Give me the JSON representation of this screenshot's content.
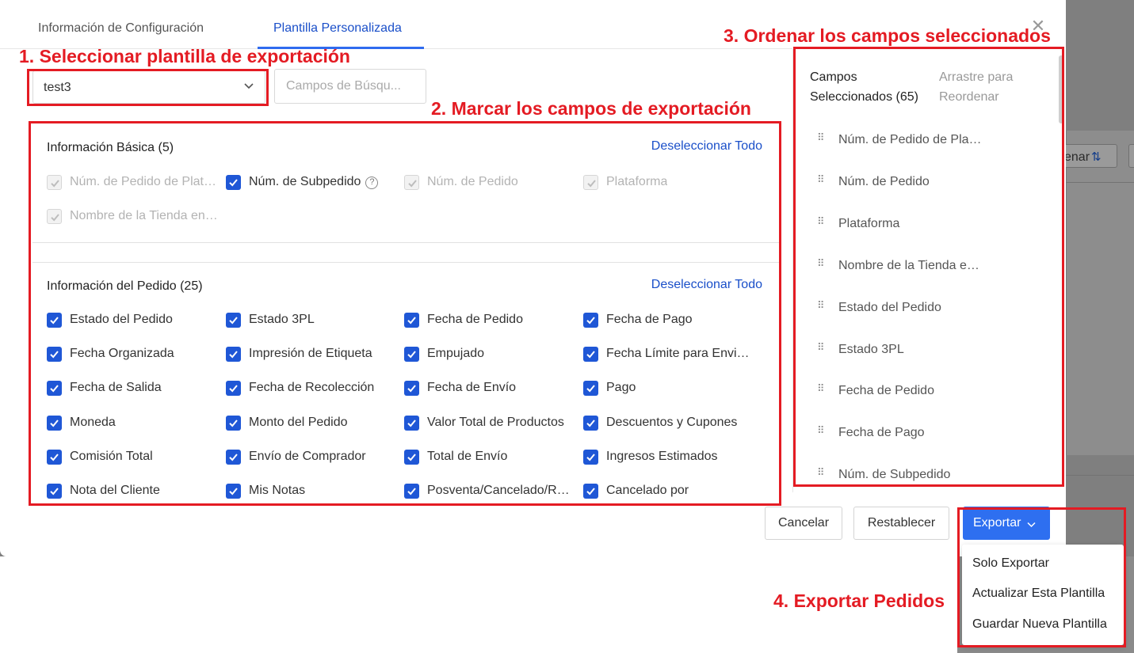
{
  "tabs": [
    {
      "label": "Información de Configuración"
    },
    {
      "label": "Plantilla Personalizada"
    }
  ],
  "template_select": {
    "value": "test3"
  },
  "search": {
    "placeholder": "Campos de Búsqu..."
  },
  "sections": [
    {
      "title": "Información Básica (5)",
      "action": "Deseleccionar Todo",
      "fields": [
        {
          "label": "Núm. de Pedido de Plat…",
          "checked": true,
          "disabled": true
        },
        {
          "label": "Núm. de Subpedido",
          "checked": true,
          "disabled": false,
          "help": "?"
        },
        {
          "label": "Núm. de Pedido",
          "checked": true,
          "disabled": true
        },
        {
          "label": "Plataforma",
          "checked": true,
          "disabled": true
        },
        {
          "label": "Nombre de la Tienda en…",
          "checked": true,
          "disabled": true
        }
      ]
    },
    {
      "title": "Información del Pedido (25)",
      "action": "Deseleccionar Todo",
      "fields": [
        {
          "label": "Estado del Pedido",
          "checked": true
        },
        {
          "label": "Estado 3PL",
          "checked": true
        },
        {
          "label": "Fecha de Pedido",
          "checked": true
        },
        {
          "label": "Fecha de Pago",
          "checked": true
        },
        {
          "label": "Fecha Organizada",
          "checked": true
        },
        {
          "label": "Impresión de Etiqueta",
          "checked": true
        },
        {
          "label": "Empujado",
          "checked": true
        },
        {
          "label": "Fecha Límite para Envi…",
          "checked": true
        },
        {
          "label": "Fecha de Salida",
          "checked": true
        },
        {
          "label": "Fecha de Recolección",
          "checked": true
        },
        {
          "label": "Fecha de Envío",
          "checked": true
        },
        {
          "label": "Pago",
          "checked": true
        },
        {
          "label": "Moneda",
          "checked": true
        },
        {
          "label": "Monto del Pedido",
          "checked": true
        },
        {
          "label": "Valor Total de Productos",
          "checked": true
        },
        {
          "label": "Descuentos y Cupones",
          "checked": true
        },
        {
          "label": "Comisión Total",
          "checked": true
        },
        {
          "label": "Envío de Comprador",
          "checked": true
        },
        {
          "label": "Total de Envío",
          "checked": true
        },
        {
          "label": "Ingresos Estimados",
          "checked": true
        },
        {
          "label": "Nota del Cliente",
          "checked": true
        },
        {
          "label": "Mis Notas",
          "checked": true
        },
        {
          "label": "Posventa/Cancelado/R…",
          "checked": true
        },
        {
          "label": "Cancelado por",
          "checked": true
        }
      ]
    }
  ],
  "selected_panel": {
    "title": "Campos Seleccionados (65)",
    "hint": "Arrastre para Reordenar",
    "items": [
      "Núm. de Pedido de Pla…",
      "Núm. de Pedido",
      "Plataforma",
      "Nombre de la Tienda e…",
      "Estado del Pedido",
      "Estado 3PL",
      "Fecha de Pedido",
      "Fecha de Pago",
      "Núm. de Subpedido"
    ]
  },
  "footer": {
    "cancel": "Cancelar",
    "reset": "Restablecer",
    "export": "Exportar"
  },
  "export_menu": [
    "Solo Exportar",
    "Actualizar Esta Plantilla",
    "Guardar Nueva Plantilla"
  ],
  "annotations": [
    "1. Seleccionar plantilla de exportación",
    "2. Marcar los campos de exportación",
    "3. Ordenar los campos seleccionados",
    "4. Exportar Pedidos"
  ],
  "background": {
    "sort_label": "enar"
  },
  "colors": {
    "primary": "#2e6ff0",
    "link": "#1a4fc9",
    "annotation": "#e41b23"
  }
}
